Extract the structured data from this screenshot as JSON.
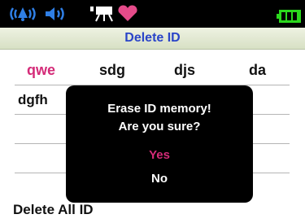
{
  "title": "Delete ID",
  "ids": [
    "qwe",
    "sdg",
    "djs",
    "da",
    "dgfh"
  ],
  "footer_label": "Delete All ID",
  "dialog": {
    "line1": "Erase ID memory!",
    "line2": "Are you sure?",
    "yes_label": "Yes",
    "no_label": "No"
  },
  "status_icons": [
    "signal-alert-icon",
    "speaker-icon",
    "projector-icon",
    "heart-icon",
    "battery-icon"
  ],
  "colors": {
    "title": "#2a44c8",
    "selected": "#d42b78",
    "icon_blue": "#2f7fe6",
    "heart": "#e54b8a",
    "battery": "#2bd81d"
  }
}
